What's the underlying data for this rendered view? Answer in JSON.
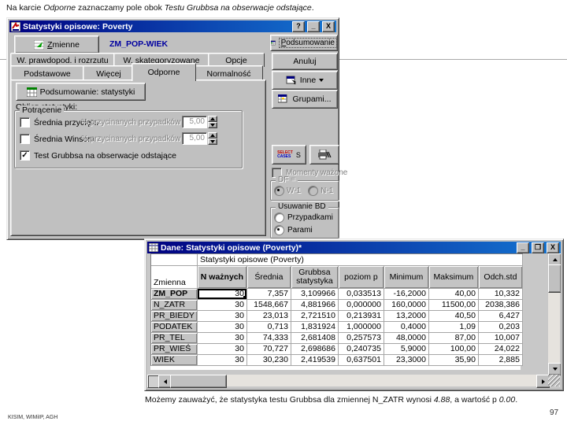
{
  "slide": {
    "intro": {
      "p1": "Na karcie ",
      "i1": "Odporne",
      "p2": " zaznaczamy pole obok ",
      "i2": "Testu Grubbsa na obserwacje odstające",
      "p3": "."
    },
    "caption": {
      "p1": "Możemy zauważyć, że statystyka testu Grubbsa dla zmiennej N_ZATR wynosi ",
      "i1": "4.88",
      "p2": ", a wartość p ",
      "i2": "0.00",
      "p3": "."
    },
    "footer_left": "KISIM, WIMiIP, AGH",
    "page_number": "97"
  },
  "dialog": {
    "title": "Statystyki opisowe: Poverty",
    "help_button": "?",
    "minimize_button": "_",
    "close_button": "X",
    "variables_button": "Zmienne",
    "selected_variables": "ZM_POP-WIEK",
    "summary_top_button": "Podsumowanie",
    "tabs_back": [
      "W. prawdopod. i rozrzutu",
      "W. skategoryzowane",
      "Opcje"
    ],
    "tabs_front": [
      "Podstawowe",
      "Więcej",
      "Odporne",
      "Normalność"
    ],
    "active_tab": "Odporne",
    "cancel_button": "Anuluj",
    "more_button": "Inne",
    "groups_button": "Grupami...",
    "summary_stats_button": "Podsumowanie: statystyki",
    "compute_label": "Oblicz statystyki:",
    "trim_group": {
      "title": "Potrącenie",
      "trimmed_mean": "Średnia przycięta",
      "winsor_mean": "Średnia Winsora",
      "pct_label": "% przycinanych przypadków",
      "pct_value_1": "5,00",
      "pct_value_2": "5,00",
      "grubbs_check": "Test Grubbsa na obserwacje odstające"
    },
    "select_cases": {
      "l1": "SELECT",
      "l2": "CASES",
      "s": "S"
    },
    "weighted_moments": "Momenty ważone",
    "df_group": {
      "title": "DF =",
      "opt1": "W-1",
      "opt2": "N-1",
      "selected": "W-1"
    },
    "md_group": {
      "title": "Usuwanie BD",
      "opt1": "Przypadkami",
      "opt2": "Parami",
      "selected": "Parami"
    }
  },
  "table_window": {
    "title": "Dane: Statystyki opisowe (Poverty)*",
    "minimize_button": "_",
    "maximize_button": "❐",
    "close_button": "X",
    "sheet_title": "Statystyki opisowe (Poverty)",
    "row_header": "Zmienna",
    "columns": [
      "N ważnych",
      "Średnia",
      "Grubbsa statystyka",
      "poziom p",
      "Minimum",
      "Maksimum",
      "Odch.std"
    ],
    "rows": [
      {
        "name": "ZM_POP",
        "v": [
          "30",
          "7,357",
          "3,109966",
          "0,033513",
          "-16,2000",
          "40,00",
          "10,332"
        ]
      },
      {
        "name": "N_ZATR",
        "v": [
          "30",
          "1548,667",
          "4,881966",
          "0,000000",
          "160,0000",
          "11500,00",
          "2038,386"
        ]
      },
      {
        "name": "PR_BIEDY",
        "v": [
          "30",
          "23,013",
          "2,721510",
          "0,213931",
          "13,2000",
          "40,50",
          "6,427"
        ]
      },
      {
        "name": "PODATEK",
        "v": [
          "30",
          "0,713",
          "1,831924",
          "1,000000",
          "0,4000",
          "1,09",
          "0,203"
        ]
      },
      {
        "name": "PR_TEL",
        "v": [
          "30",
          "74,333",
          "2,681408",
          "0,257573",
          "48,0000",
          "87,00",
          "10,007"
        ]
      },
      {
        "name": "PR_WIEŚ",
        "v": [
          "30",
          "70,727",
          "2,698686",
          "0,240735",
          "5,9000",
          "100,00",
          "24,022"
        ]
      },
      {
        "name": "WIEK",
        "v": [
          "30",
          "30,230",
          "2,419539",
          "0,637501",
          "23,3000",
          "35,90",
          "2,885"
        ]
      }
    ]
  },
  "icons": {
    "check": "✓"
  },
  "colors": {
    "titlebar_start": "#000080",
    "titlebar_end": "#1576d2",
    "chrome": "#c0c0c0",
    "link_text": "#0000a0"
  }
}
